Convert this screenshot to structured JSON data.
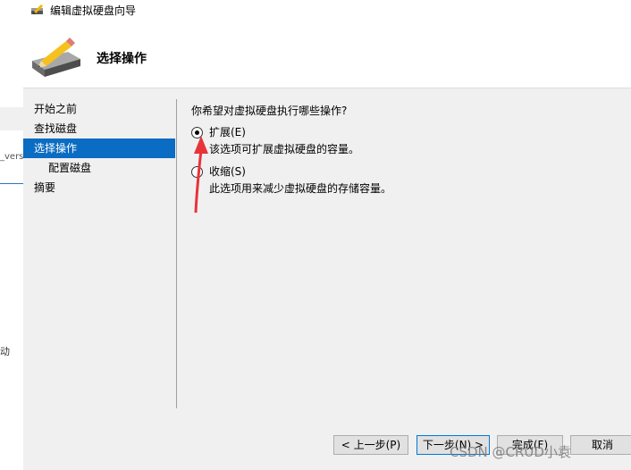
{
  "window": {
    "title": "编辑虚拟硬盘向导"
  },
  "header": {
    "title": "选择操作"
  },
  "background": {
    "fragment_1": "_vers",
    "fragment_2": "动"
  },
  "nav": {
    "items": [
      {
        "label": "开始之前",
        "active": false,
        "sub": false
      },
      {
        "label": "查找磁盘",
        "active": false,
        "sub": false
      },
      {
        "label": "选择操作",
        "active": true,
        "sub": false
      },
      {
        "label": "配置磁盘",
        "active": false,
        "sub": true
      },
      {
        "label": "摘要",
        "active": false,
        "sub": false
      }
    ]
  },
  "main": {
    "question": "你希望对虚拟硬盘执行哪些操作?",
    "options": [
      {
        "label": "扩展(E)",
        "description": "该选项可扩展虚拟硬盘的容量。",
        "checked": true
      },
      {
        "label": "收缩(S)",
        "description": "此选项用来减少虚拟硬盘的存储容量。",
        "checked": false
      }
    ]
  },
  "footer": {
    "prev_label": "< 上一步(P)",
    "next_label": "下一步(N) >",
    "finish_label": "完成(F)",
    "cancel_label": "取消"
  },
  "watermark": "CSDN @CRUD小袁",
  "colors": {
    "selection": "#0a6cc2",
    "annotation_arrow": "#e8333a"
  },
  "icons": {
    "title": "pencil-disk-icon",
    "header": "pencil-disk-icon"
  }
}
